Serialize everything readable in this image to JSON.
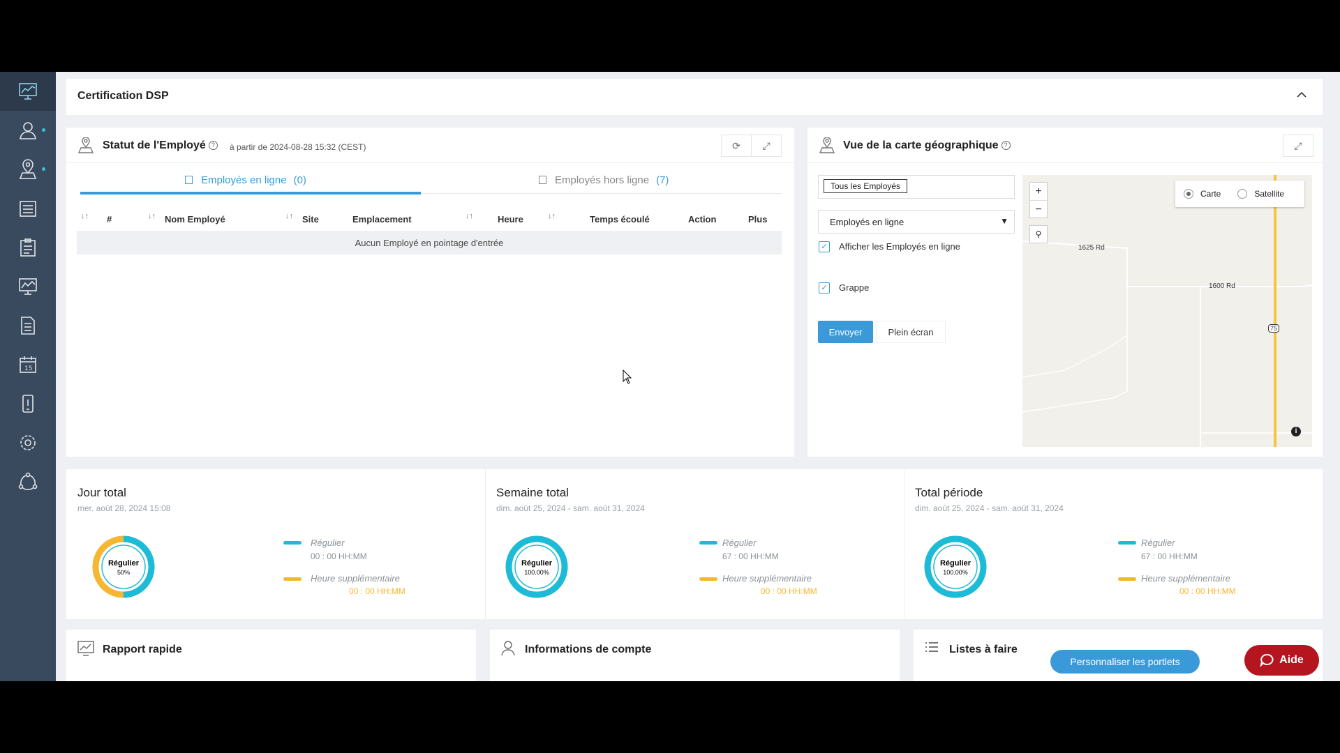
{
  "certification": {
    "title": "Certification DSP"
  },
  "employee_status": {
    "title": "Statut de l'Employé",
    "subtitle": "à partir de 2024-08-28 15:32 (CEST)",
    "tabs": [
      {
        "label": "Employés en ligne",
        "count": "(0)",
        "active": true
      },
      {
        "label": "Employés hors ligne",
        "count": "(7)",
        "active": false
      }
    ],
    "columns": [
      "#",
      "Nom Employé",
      "Site",
      "Emplacement",
      "Heure",
      "Temps écoulé",
      "Action",
      "Plus"
    ],
    "empty_message": "Aucun Employé en pointage d'entrée"
  },
  "map_view": {
    "title": "Vue de la carte géographique",
    "employee_filter": "Tous les Employés",
    "status_select": "Employés en ligne",
    "show_online_label": "Afficher les Employés en ligne",
    "show_online_checked": true,
    "cluster_label": "Grappe",
    "cluster_checked": true,
    "send_label": "Envoyer",
    "fullscreen_label": "Plein écran",
    "map_type_options": [
      "Carte",
      "Satellite"
    ],
    "map_type_selected": "Carte",
    "road_labels": [
      "1625 Rd",
      "1600 Rd",
      "75"
    ],
    "zoom_in": "+",
    "zoom_out": "−"
  },
  "totals": [
    {
      "title": "Jour total",
      "subtitle": "mer. août 28, 2024 15:08",
      "donut_label": "Régulier",
      "donut_percent": "50%",
      "regular_fraction": 0.5,
      "regular_label": "Régulier",
      "regular_value": "00 : 00 HH:MM",
      "overtime_label": "Heure supplémentaire",
      "overtime_value": "00 : 00 HH:MM"
    },
    {
      "title": "Semaine total",
      "subtitle": "dim. août 25, 2024 - sam. août 31, 2024",
      "donut_label": "Régulier",
      "donut_percent": "100.00%",
      "regular_fraction": 1.0,
      "regular_label": "Régulier",
      "regular_value": "67 : 00 HH:MM",
      "overtime_label": "Heure supplémentaire",
      "overtime_value": "00 : 00 HH:MM"
    },
    {
      "title": "Total période",
      "subtitle": "dim. août 25, 2024 - sam. août 31, 2024",
      "donut_label": "Régulier",
      "donut_percent": "100.00%",
      "regular_fraction": 1.0,
      "regular_label": "Régulier",
      "regular_value": "67 : 00 HH:MM",
      "overtime_label": "Heure supplémentaire",
      "overtime_value": "00 : 00 HH:MM"
    }
  ],
  "bottom_cards": [
    {
      "title": "Rapport rapide",
      "icon": "chart-icon"
    },
    {
      "title": "Informations de compte",
      "icon": "user-icon"
    },
    {
      "title": "Listes à faire",
      "icon": "list-icon"
    }
  ],
  "buttons": {
    "portlets": "Personnaliser les portlets",
    "help": "Aide"
  },
  "colors": {
    "primary": "#3a9ad9",
    "regular": "#1cbcd8",
    "overtime": "#f5b731",
    "help": "#b4151f",
    "sidebar": "#3a4a5e"
  },
  "sidebar_icons": [
    "dashboard-icon",
    "employees-icon",
    "location-icon",
    "timesheet-icon",
    "tasks-icon",
    "reports-icon",
    "document-icon",
    "calendar-icon",
    "mobile-icon",
    "settings-icon",
    "integrations-icon"
  ]
}
